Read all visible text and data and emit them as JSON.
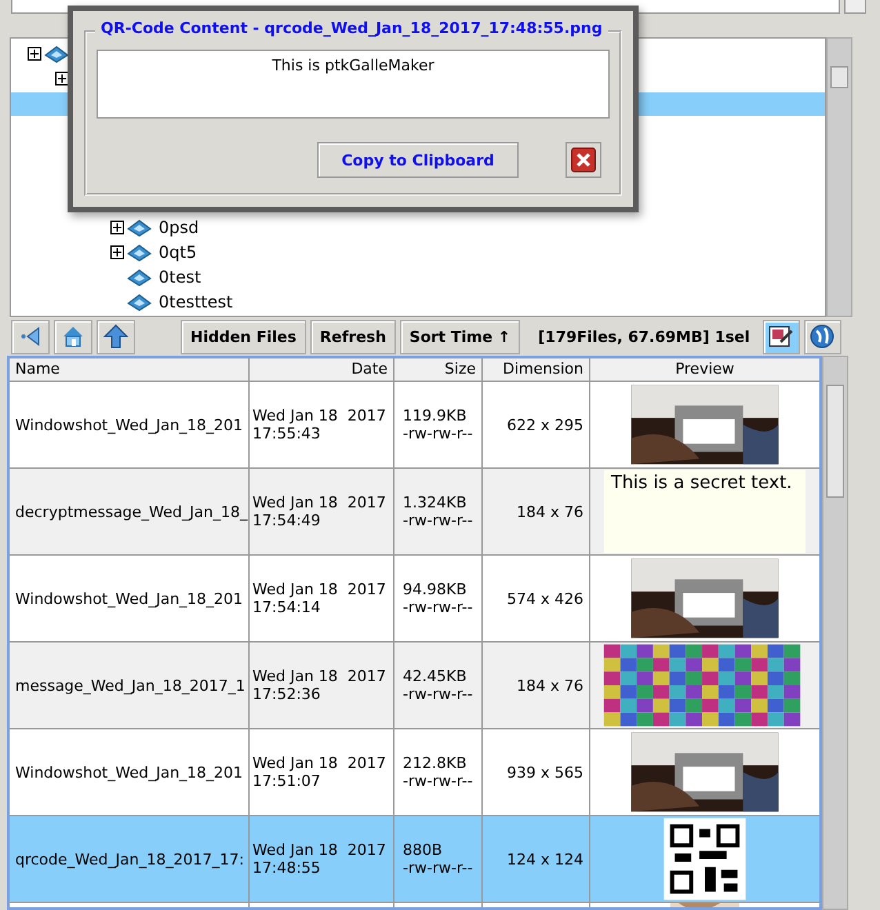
{
  "tree": {
    "items": [
      {
        "icon": true,
        "expandable": true,
        "selected": false,
        "children": [
          {
            "expandable": true,
            "selected": false,
            "children": [
              {
                "expandable": false,
                "selected": true,
                "children": [
                  {
                    "label": "0psd",
                    "expandable": true,
                    "selected": false
                  },
                  {
                    "label": "0qt5",
                    "expandable": true,
                    "selected": false
                  },
                  {
                    "label": "0test",
                    "expandable": false,
                    "selected": false
                  },
                  {
                    "label": "0testtest",
                    "expandable": false,
                    "selected": false
                  }
                ]
              }
            ]
          }
        ]
      }
    ]
  },
  "toolbar": {
    "buttons": [
      {
        "label": "Hidden Files"
      },
      {
        "label": "Refresh"
      },
      {
        "label": "Sort Time ↑"
      }
    ],
    "status": "[179Files, 67.69MB] 1sel",
    "views": [
      {
        "selected": true
      },
      {
        "selected": false
      }
    ]
  },
  "table": {
    "columns": [
      "Name",
      "Date",
      "Size",
      "Dimension",
      "Preview"
    ],
    "rows": [
      {
        "name": "Windowshot_Wed_Jan_18_201",
        "date": "Wed Jan 18  2017\n17:55:43",
        "size": "119.9KB\n-rw-rw-r--",
        "dimension": "622 x 295",
        "preview": {
          "kind": "screenshot"
        },
        "selected": false
      },
      {
        "name": "decryptmessage_Wed_Jan_18_",
        "date": "Wed Jan 18  2017\n17:54:49",
        "size": "1.324KB\n-rw-rw-r--",
        "dimension": "184 x 76",
        "preview": {
          "kind": "text",
          "text": "This is a secret text."
        },
        "selected": false
      },
      {
        "name": "Windowshot_Wed_Jan_18_201",
        "date": "Wed Jan 18  2017\n17:54:14",
        "size": "94.98KB\n-rw-rw-r--",
        "dimension": "574 x 426",
        "preview": {
          "kind": "screenshot"
        },
        "selected": false
      },
      {
        "name": "message_Wed_Jan_18_2017_1",
        "date": "Wed Jan 18  2017\n17:52:36",
        "size": "42.45KB\n-rw-rw-r--",
        "dimension": "184 x 76",
        "preview": {
          "kind": "noise"
        },
        "selected": false
      },
      {
        "name": "Windowshot_Wed_Jan_18_201",
        "date": "Wed Jan 18  2017\n17:51:07",
        "size": "212.8KB\n-rw-rw-r--",
        "dimension": "939 x 565",
        "preview": {
          "kind": "screenshot"
        },
        "selected": false
      },
      {
        "name": "qrcode_Wed_Jan_18_2017_17:",
        "date": "Wed Jan 18  2017\n17:48:55",
        "size": "880B\n-rw-rw-r--",
        "dimension": "124 x 124",
        "preview": {
          "kind": "qr"
        },
        "selected": true
      },
      {
        "selected": false
      }
    ]
  },
  "dialog": {
    "title": "QR-Code Content - qrcode_Wed_Jan_18_2017_17:48:55.png",
    "content": "This is ptkGalleMaker",
    "button": "Copy to Clipboard"
  }
}
